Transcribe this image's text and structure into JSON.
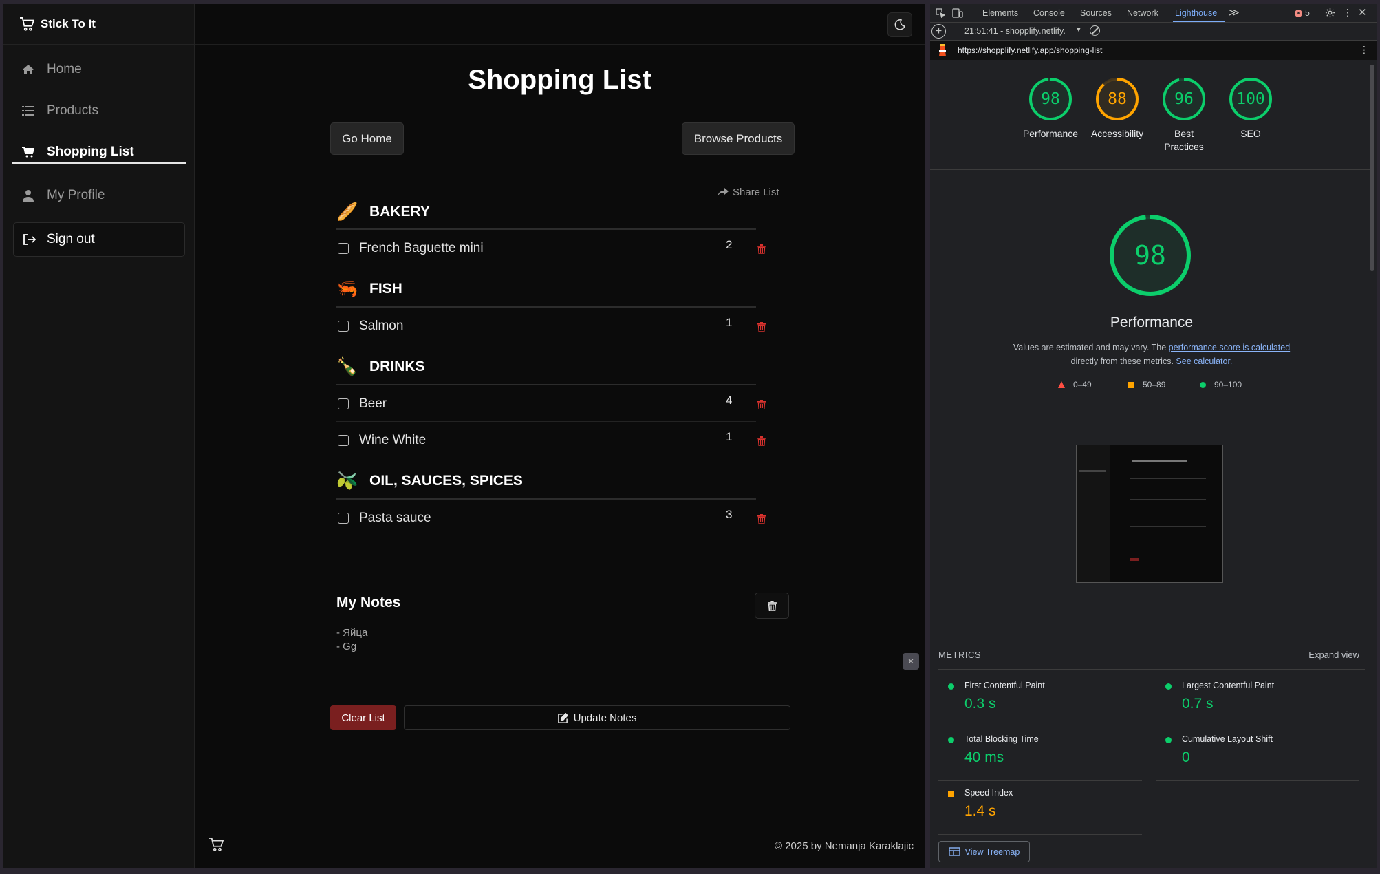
{
  "app": {
    "brand": "Stick To It",
    "nav": [
      {
        "label": "Home",
        "icon": "home-icon"
      },
      {
        "label": "Products",
        "icon": "list-icon"
      },
      {
        "label": "Shopping List",
        "icon": "cart-icon"
      },
      {
        "label": "My Profile",
        "icon": "user-icon"
      }
    ],
    "signout": "Sign out",
    "page_title": "Shopping List",
    "go_home": "Go Home",
    "browse_products": "Browse Products",
    "share_list": "Share List",
    "categories": [
      {
        "name": "BAKERY",
        "emoji": "🥖",
        "items": [
          {
            "name": "French Baguette mini",
            "qty": "2"
          }
        ]
      },
      {
        "name": "FISH",
        "emoji": "🦐",
        "items": [
          {
            "name": "Salmon",
            "qty": "1"
          }
        ]
      },
      {
        "name": "DRINKS",
        "emoji": "🍾",
        "items": [
          {
            "name": "Beer",
            "qty": "4"
          },
          {
            "name": "Wine White",
            "qty": "1"
          }
        ]
      },
      {
        "name": "OIL, SAUCES, SPICES",
        "emoji": "🫒",
        "items": [
          {
            "name": "Pasta sauce",
            "qty": "3"
          }
        ]
      }
    ],
    "notes_title": "My Notes",
    "notes": [
      "- Яйца",
      "- Gg"
    ],
    "clear_list": "Clear List",
    "update_notes": "Update Notes",
    "footer": "© 2025 by Nemanja Karaklajic",
    "colors": {
      "danger": "#d9322e",
      "accent_red_btn": "#7a1f1f"
    }
  },
  "devtools": {
    "tabs": [
      "Elements",
      "Console",
      "Sources",
      "Network",
      "Lighthouse"
    ],
    "active_tab": "Lighthouse",
    "more": "≫",
    "error_count": "5",
    "report_time": "21:51:41 - shopplify.netlify.",
    "url": "https://shopplify.netlify.app/shopping-list",
    "scores": [
      {
        "label": "Performance",
        "value": 98,
        "color": "#0cce6b"
      },
      {
        "label": "Accessibility",
        "value": 88,
        "color": "#ffa400"
      },
      {
        "label": "Best Practices",
        "value": 96,
        "color": "#0cce6b"
      },
      {
        "label": "SEO",
        "value": 100,
        "color": "#0cce6b"
      }
    ],
    "main_score": 98,
    "main_title": "Performance",
    "desc_1": "Values are estimated and may vary. The",
    "desc_link_1": "performance score is calculated",
    "desc_2": "directly from these metrics.",
    "desc_link_2": "See calculator.",
    "legend": [
      "0–49",
      "50–89",
      "90–100"
    ],
    "metrics_header": "METRICS",
    "expand_view": "Expand view",
    "metrics": [
      {
        "name": "First Contentful Paint",
        "value": "0.3 s",
        "status": "good"
      },
      {
        "name": "Largest Contentful Paint",
        "value": "0.7 s",
        "status": "good"
      },
      {
        "name": "Total Blocking Time",
        "value": "40 ms",
        "status": "good"
      },
      {
        "name": "Cumulative Layout Shift",
        "value": "0",
        "status": "good"
      },
      {
        "name": "Speed Index",
        "value": "1.4 s",
        "status": "average"
      }
    ],
    "treemap": "View Treemap"
  }
}
